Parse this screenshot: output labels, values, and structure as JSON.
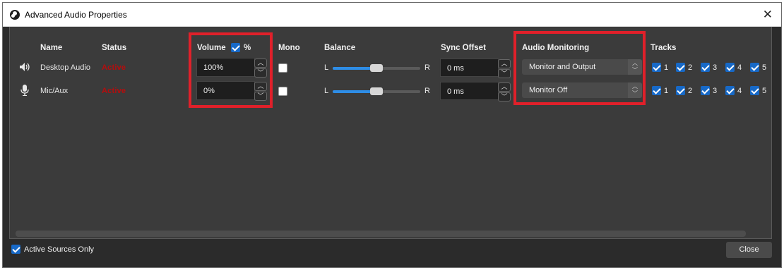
{
  "window": {
    "title": "Advanced Audio Properties",
    "close_glyph": "✕"
  },
  "headers": {
    "name": "Name",
    "status": "Status",
    "volume": "Volume",
    "percent": "%",
    "mono": "Mono",
    "balance": "Balance",
    "sync_offset": "Sync Offset",
    "audio_monitoring": "Audio Monitoring",
    "tracks": "Tracks"
  },
  "rows": [
    {
      "name": "Desktop Audio",
      "icon": "speaker-icon",
      "status": "Active",
      "volume": "100%",
      "mono": false,
      "balance_left": "L",
      "balance_right": "R",
      "balance_value": 0.5,
      "sync_offset": "0 ms",
      "monitoring": "Monitor and Output",
      "tracks": [
        "1",
        "2",
        "3",
        "4",
        "5"
      ]
    },
    {
      "name": "Mic/Aux",
      "icon": "microphone-icon",
      "status": "Active",
      "volume": "0%",
      "mono": false,
      "balance_left": "L",
      "balance_right": "R",
      "balance_value": 0.5,
      "sync_offset": "0 ms",
      "monitoring": "Monitor Off",
      "tracks": [
        "1",
        "2",
        "3",
        "4",
        "5"
      ]
    }
  ],
  "footer": {
    "active_sources_only": "Active Sources Only",
    "close": "Close"
  },
  "colors": {
    "status_active": "#b50d0d",
    "accent": "#1769c7",
    "highlight": "#e0202a"
  }
}
